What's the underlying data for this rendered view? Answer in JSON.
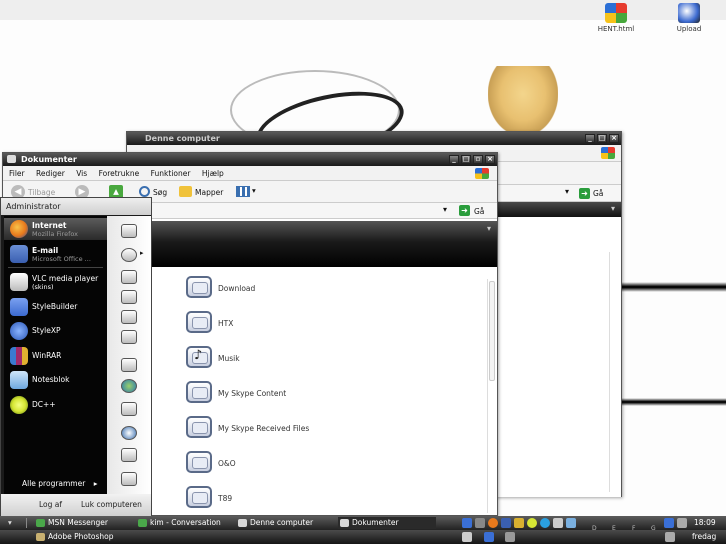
{
  "desktop": {
    "icons": [
      {
        "label": "HENT.html",
        "icon": "windows-flag-icon"
      },
      {
        "label": "Upload",
        "icon": "upload-icon"
      }
    ]
  },
  "back_window": {
    "title": "Denne computer",
    "go_label": "Gå"
  },
  "front_window": {
    "title": "Dokumenter",
    "menu": [
      "Filer",
      "Rediger",
      "Vis",
      "Foretrukne",
      "Funktioner",
      "Hjælp"
    ],
    "toolbar": {
      "back_label": "Tilbage",
      "search_label": "Søg",
      "folders_label": "Mapper"
    },
    "go_label": "Gå",
    "files": [
      "Download",
      "HTX",
      "Musik",
      "My Skype Content",
      "My Skype Received Files",
      "O&O",
      "T89"
    ]
  },
  "start_menu": {
    "user": "Administrator",
    "pinned": [
      {
        "title": "Internet",
        "subtitle": "Mozilla Firefox",
        "icon": "firefox-icon",
        "color": "#e8791c"
      },
      {
        "title": "E-mail",
        "subtitle": "Microsoft Office ...",
        "icon": "outlook-icon",
        "color": "#3a5fb0"
      }
    ],
    "recent": [
      {
        "title": "VLC media player",
        "subtitle": "(skins)",
        "icon": "vlc-icon",
        "color": "#e0e0e0"
      },
      {
        "title": "StyleBuilder",
        "icon": "stylebuilder-icon",
        "color": "#3c6ad0"
      },
      {
        "title": "StyleXP",
        "icon": "stylexp-icon",
        "color": "#2b57b8"
      },
      {
        "title": "WinRAR",
        "icon": "winrar-icon",
        "color": "#a02a6a"
      },
      {
        "title": "Notesblok",
        "icon": "notepad-icon",
        "color": "#6ea8e0"
      },
      {
        "title": "DC++",
        "icon": "dcpp-icon",
        "color": "#d6e634"
      }
    ],
    "all_programs": "Alle programmer",
    "logoff": "Log af",
    "shutdown": "Luk computeren"
  },
  "taskbar": {
    "tasks": [
      {
        "label": "MSN Messenger",
        "icon": "msn-icon",
        "color": "#4aa84a"
      },
      {
        "label": "kim - Conversation",
        "icon": "msn-conversation-icon",
        "color": "#4aa84a"
      },
      {
        "label": "Denne computer",
        "icon": "computer-icon",
        "color": "#d8d8d8"
      },
      {
        "label": "Dokumenter",
        "icon": "folder-icon",
        "color": "#d8d8d8"
      }
    ],
    "letters": [
      "D",
      "E",
      "F",
      "G"
    ],
    "clock": "18:09",
    "day": "fredag"
  },
  "taskbar2": {
    "task": "Adobe Photoshop"
  }
}
